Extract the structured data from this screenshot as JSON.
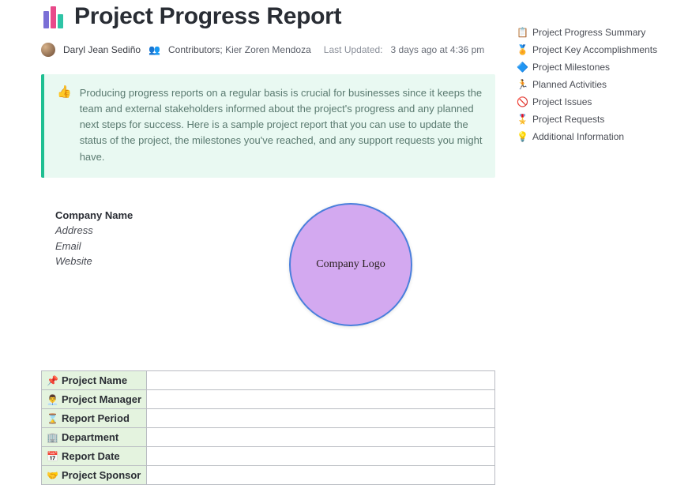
{
  "header": {
    "title": "Project Progress Report",
    "author": "Daryl Jean Sediño",
    "contributors_label": "Contributors",
    "contributors_names": "Kier Zoren Mendoza",
    "updated_label": "Last Updated:",
    "updated_value": "3 days ago at 4:36 pm"
  },
  "callout": {
    "text": "Producing progress reports on a regular basis is crucial for businesses since it keeps the team and external stakeholders informed about the project's progress and any planned next steps for success. Here is a sample project report that you can use to update the status of the project, the milestones you've reached, and any support requests you might have."
  },
  "company": {
    "name_label": "Company Name",
    "address": "Address",
    "email": "Email",
    "website": "Website",
    "logo_text": "Company Logo"
  },
  "table_rows": [
    {
      "icon": "📌",
      "label": "Project Name"
    },
    {
      "icon": "👨‍💼",
      "label": "Project Manager"
    },
    {
      "icon": "⌛",
      "label": "Report Period"
    },
    {
      "icon": "🏢",
      "label": "Department"
    },
    {
      "icon": "📅",
      "label": "Report Date"
    },
    {
      "icon": "🤝",
      "label": "Project Sponsor"
    }
  ],
  "toc": [
    {
      "icon": "📋",
      "label": "Project Progress Summary"
    },
    {
      "icon": "🏅",
      "label": "Project Key Accomplishments"
    },
    {
      "icon": "🔷",
      "label": "Project Milestones"
    },
    {
      "icon": "🏃",
      "label": "Planned Activities"
    },
    {
      "icon": "🚫",
      "label": "Project Issues"
    },
    {
      "icon": "🎖️",
      "label": "Project Requests"
    },
    {
      "icon": "💡",
      "label": "Additional Information"
    }
  ]
}
